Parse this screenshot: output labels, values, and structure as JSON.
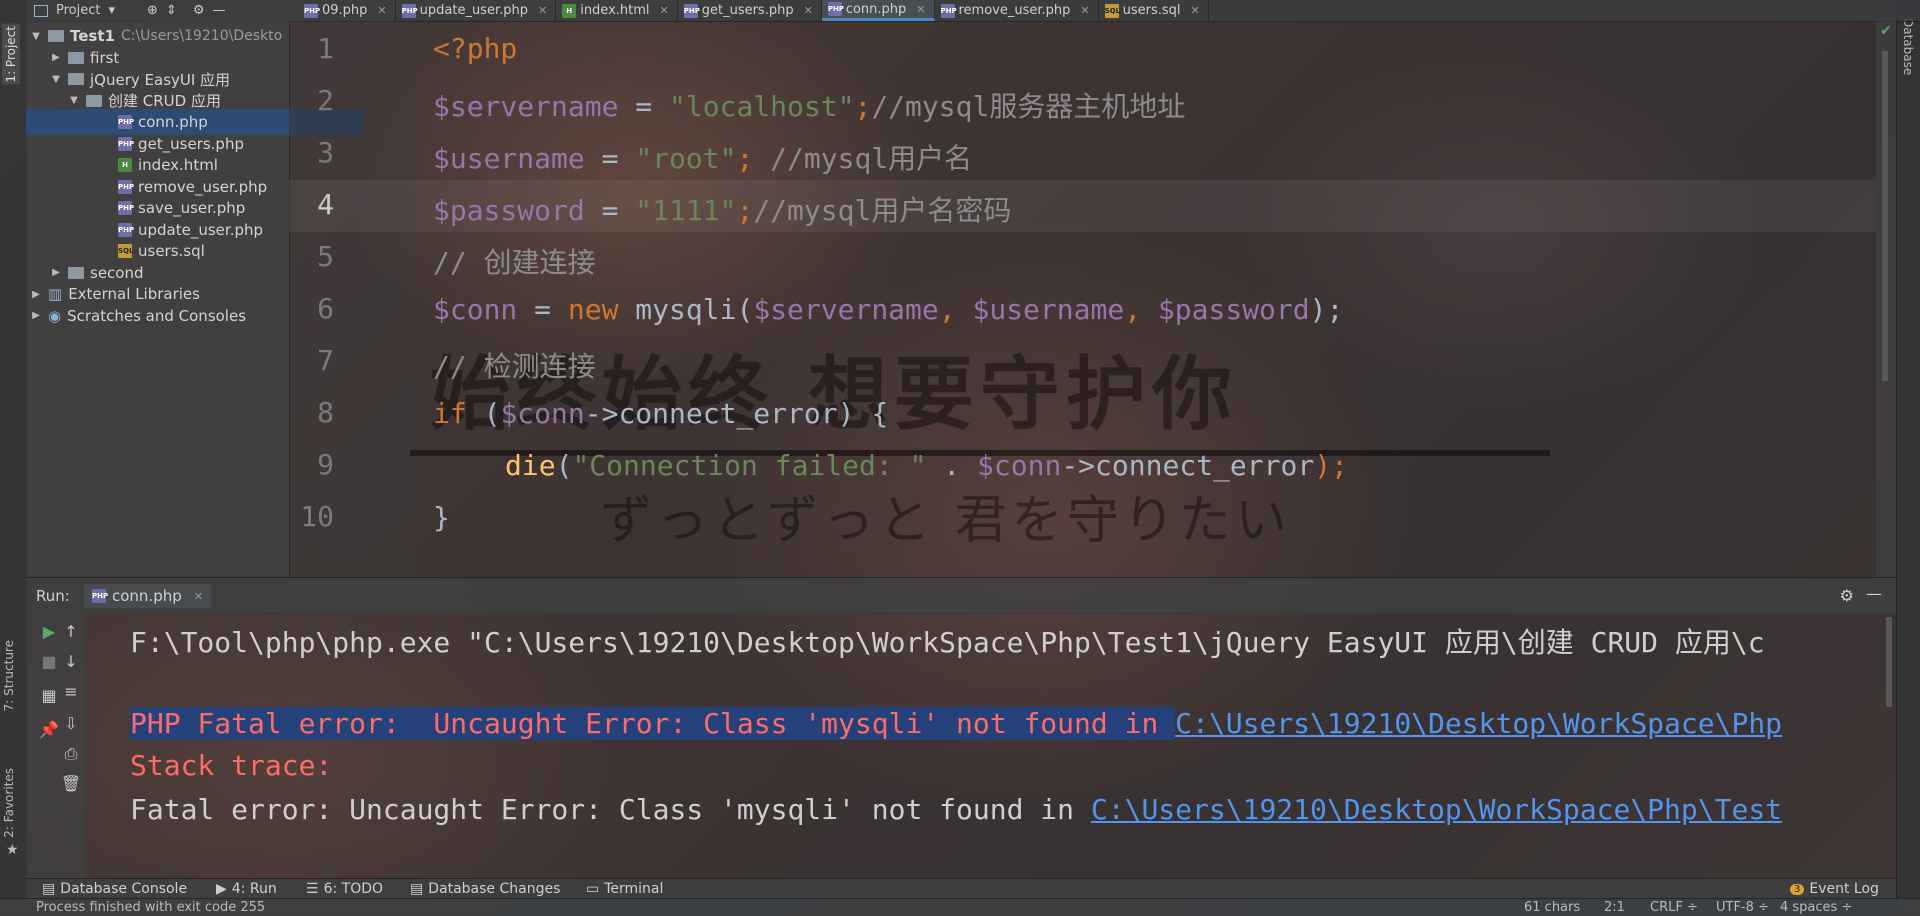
{
  "side_tabs": {
    "project": "1: Project",
    "structure": "7: Structure",
    "favorites": "2: Favorites",
    "database": "Database"
  },
  "project_header": {
    "label": "Project",
    "dropdown": "▾"
  },
  "editor_tabs": [
    {
      "label": "09.php",
      "type": "php"
    },
    {
      "label": "update_user.php",
      "type": "php"
    },
    {
      "label": "index.html",
      "type": "html"
    },
    {
      "label": "get_users.php",
      "type": "php"
    },
    {
      "label": "conn.php",
      "type": "php",
      "active": true
    },
    {
      "label": "remove_user.php",
      "type": "php"
    },
    {
      "label": "users.sql",
      "type": "sql"
    }
  ],
  "tree": [
    {
      "label": "Test1",
      "path": "C:\\Users\\19210\\Deskto",
      "level": 0,
      "arrow": "▼",
      "icon": "folder"
    },
    {
      "label": "first",
      "level": 1,
      "arrow": "▶",
      "icon": "folder"
    },
    {
      "label": "jQuery EasyUI 应用",
      "level": 1,
      "arrow": "▼",
      "icon": "folder"
    },
    {
      "label": "创建 CRUD 应用",
      "level": 2,
      "arrow": "▼",
      "icon": "folder"
    },
    {
      "label": "conn.php",
      "level": 3,
      "icon": "php",
      "selected": true
    },
    {
      "label": "get_users.php",
      "level": 3,
      "icon": "php"
    },
    {
      "label": "index.html",
      "level": 3,
      "icon": "html"
    },
    {
      "label": "remove_user.php",
      "level": 3,
      "icon": "php"
    },
    {
      "label": "save_user.php",
      "level": 3,
      "icon": "php"
    },
    {
      "label": "update_user.php",
      "level": 3,
      "icon": "php"
    },
    {
      "label": "users.sql",
      "level": 3,
      "icon": "sql"
    },
    {
      "label": "second",
      "level": 1,
      "arrow": "▶",
      "icon": "folder"
    },
    {
      "label": "External Libraries",
      "level": 0,
      "arrow": "▶",
      "icon": "libs"
    },
    {
      "label": "Scratches and Consoles",
      "level": 0,
      "arrow": "▶",
      "icon": "scratch"
    }
  ],
  "line_numbers": [
    "1",
    "2",
    "3",
    "4",
    "5",
    "6",
    "7",
    "8",
    "9",
    "10"
  ],
  "code": {
    "l1": "<?php",
    "l2_var": "$servername",
    "l2_eq": " = ",
    "l2_str": "\"localhost\"",
    "l2_semi": ";",
    "l2_cm": "//mysql服务器主机地址",
    "l3_var": "$username",
    "l3_eq": " = ",
    "l3_str": "\"root\"",
    "l3_semi": ";",
    "l3_cm": " //mysql用户名",
    "l4_var": "$password",
    "l4_eq": " = ",
    "l4_str": "\"1111\"",
    "l4_semi": ";",
    "l4_cm": "//mysql用户名密码",
    "l5": "// 创建连接",
    "l6_var": "$conn",
    "l6_eq": " = ",
    "l6_new": "new",
    "l6_fn": " mysqli(",
    "l6_a1": "$servername",
    "l6_c1": ", ",
    "l6_a2": "$username",
    "l6_c2": ", ",
    "l6_a3": "$password",
    "l6_end": ");",
    "l7": "// 检测连接",
    "l8_if": "if",
    "l8_p": " (",
    "l8_var": "$conn",
    "l8_arrow": "->connect_error",
    "l8_end": ") {",
    "l9_die": "die",
    "l9_p": "(",
    "l9_str": "\"Connection failed: \"",
    "l9_dot": " . ",
    "l9_var": "$conn",
    "l9_arrow": "->connect_error",
    "l9_end": ");",
    "l10": "}"
  },
  "watermark": {
    "main": "始终始终 想要守护你",
    "sub": "ずっとずっと 君を守りたい"
  },
  "run": {
    "label": "Run:",
    "tab": "conn.php",
    "console": {
      "line1": "F:\\Tool\\php\\php.exe \"C:\\Users\\19210\\Desktop\\WorkSpace\\Php\\Test1\\jQuery EasyUI 应用\\创建 CRUD 应用\\c",
      "line2_err": "PHP Fatal error:  Uncaught Error: Class 'mysqli' not found in ",
      "line2_link": "C:\\Users\\19210\\Desktop\\WorkSpace\\Php",
      "line3": "Stack trace:",
      "line4_text": "Fatal error: Uncaught Error: Class 'mysqli' not found in ",
      "line4_link": "C:\\Users\\19210\\Desktop\\WorkSpace\\Php\\Test"
    }
  },
  "bottom_tools": [
    {
      "label": "Database Console",
      "icon": "▤"
    },
    {
      "label": "4: Run",
      "icon": "▶"
    },
    {
      "label": "6: TODO",
      "icon": "☰"
    },
    {
      "label": "Database Changes",
      "icon": "▤"
    },
    {
      "label": "Terminal",
      "icon": "▭"
    }
  ],
  "event_log": {
    "label": "Event Log",
    "count": "3"
  },
  "status": {
    "message": "Process finished with exit code 255",
    "chars": "61 chars",
    "position": "2:1",
    "line_sep": "CRLF ÷",
    "encoding": "UTF-8 ÷",
    "indent": "4 spaces ÷"
  },
  "colors": {
    "keyword": "#cc7832",
    "variable": "#9876aa",
    "string": "#6a8759",
    "comment": "#8c8c8c",
    "function": "#ffc66d",
    "error": "#ff6b68",
    "link": "#5394ec",
    "selection": "#214283"
  }
}
